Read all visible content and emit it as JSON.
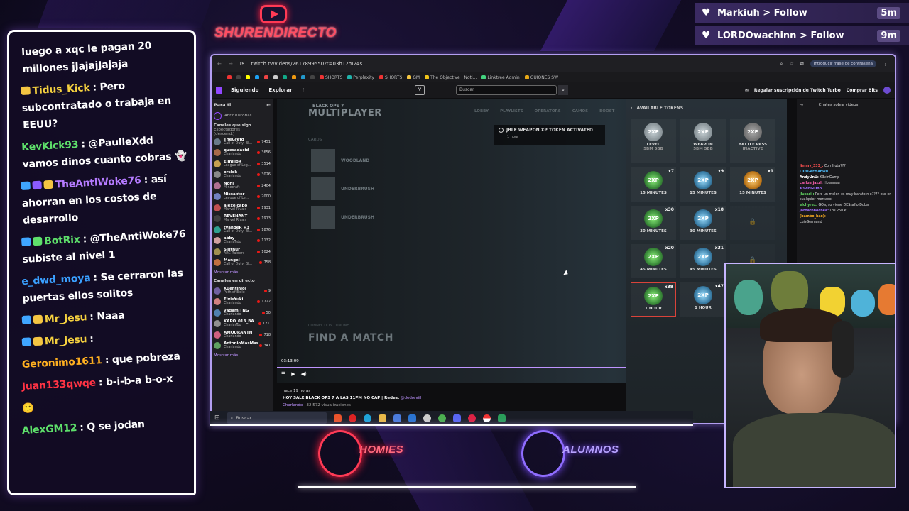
{
  "overlay": {
    "channel_name": "SHURENDIRECTO",
    "alerts": [
      {
        "user": "Markiuh",
        "action": "> Follow",
        "time": "5m"
      },
      {
        "user": "LORDOwachinn",
        "action": "> Follow",
        "time": "9m"
      }
    ],
    "bottom_logos": [
      "HOMIES",
      "ALUMNOS"
    ],
    "colors": {
      "accent_red": "#ff3a55",
      "accent_purple": "#8f6dff",
      "frame": "#ffffff"
    }
  },
  "chat": [
    {
      "user": "",
      "color": "#ffffff",
      "text": "luego a xqc le pagan 20 millones jJajajJajaja",
      "badges": []
    },
    {
      "user": "Tidus_Kick",
      "color": "#f4d03f",
      "text": ": Pero subcontratado o trabaja en EEUU?",
      "badges": [
        "#f4c542"
      ]
    },
    {
      "user": "KevKick93",
      "color": "#5ee06b",
      "text": ": @PaulleXdd vamos dinos cuanto cobras 👻",
      "badges": []
    },
    {
      "user": "TheAntiWoke76",
      "color": "#b57bff",
      "text": ": así ahorran en los costos de desarrollo",
      "badges": [
        "#3fa6ff",
        "#8b5cff",
        "#f4c542"
      ]
    },
    {
      "user": "BotRix",
      "color": "#5ee06b",
      "text": ": @TheAntiWoke76 subiste al nivel 1",
      "badges": [
        "#3fa6ff",
        "#5ee06b"
      ]
    },
    {
      "user": "e_dwd_moya",
      "color": "#3aa0ff",
      "text": ": Se cerraron las puertas ellos solitos",
      "badges": []
    },
    {
      "user": "Mr_Jesu",
      "color": "#f4d03f",
      "text": ": Naaa",
      "badges": [
        "#3fa6ff",
        "#f4c542"
      ]
    },
    {
      "user": "Mr_Jesu",
      "color": "#f4d03f",
      "text": ":",
      "badges": [
        "#3fa6ff",
        "#f4c542"
      ]
    },
    {
      "user": "Geronimo1611",
      "color": "#ffb020",
      "text": ": que pobreza",
      "badges": []
    },
    {
      "user": "Juan133qwqe",
      "color": "#ff3344",
      "text": ": b-i-b-a b-o-x",
      "badges": []
    },
    {
      "user": "",
      "color": "#ffffff",
      "text": "🙂",
      "badges": []
    },
    {
      "user": "AlexGM12",
      "color": "#5ee06b",
      "text": ": Q se jodan",
      "badges": []
    }
  ],
  "browser": {
    "url": "twitch.tv/videos/2617899550?t=03h12m24s",
    "password_prompt": "Introducir frase de contraseña",
    "bookmarks": [
      "SHORTS",
      "Perplexity",
      "SHORTS",
      "GM",
      "The Objective | Noti...",
      "Linktree Admin",
      "GUIONES SW"
    ],
    "twitch_nav": {
      "following": "Siguiendo",
      "browse": "Explorar",
      "search_placeholder": "Buscar",
      "turbo": "Regalar suscripción de Twitch Turbo",
      "bits": "Comprar Bits"
    },
    "sidebar": {
      "for_you": "Para ti",
      "open_history": "Abrir historias",
      "followed_header": "Canales que sigo",
      "followed_sub": "Espectadores (descend.)",
      "channels": [
        {
          "name": "TheGrefg",
          "game": "Call of Duty: Bl...",
          "viewers": "7451",
          "color": "#6a7a8a"
        },
        {
          "name": "quesadacid",
          "game": "Charlando",
          "viewers": "3656",
          "color": "#a86a4a"
        },
        {
          "name": "ElmilloR",
          "game": "League of Leg...",
          "viewers": "3514",
          "color": "#c6a050"
        },
        {
          "name": "orslok",
          "game": "Charlando",
          "viewers": "3026",
          "color": "#888888"
        },
        {
          "name": "Noni",
          "game": "Minecraft",
          "viewers": "2404",
          "color": "#b07090"
        },
        {
          "name": "Nissaxter",
          "game": "League of Le...",
          "viewers": "2000",
          "color": "#7080c0"
        },
        {
          "name": "alexelcapo",
          "game": "Marvel Rivals",
          "viewers": "1931",
          "color": "#c05050"
        },
        {
          "name": "REVENANT",
          "game": "Marvel Rivals",
          "viewers": "1913",
          "color": "#404040"
        },
        {
          "name": "tvandeR +3",
          "game": "Call of Duty: Bl...",
          "viewers": "1876",
          "color": "#30a090"
        },
        {
          "name": "abby_",
          "game": "Charlando",
          "viewers": "1132",
          "color": "#d0a0a0"
        },
        {
          "name": "Sillthur",
          "game": "ARC Raiders",
          "viewers": "1024",
          "color": "#a09050"
        },
        {
          "name": "Mangel",
          "game": "Call of Duty: Bl...",
          "viewers": "758",
          "color": "#c07040"
        }
      ],
      "show_more": "Mostrar más",
      "live_header": "Canales en directo",
      "live_channels": [
        {
          "name": "Kuentinlol",
          "game": "Path of Exile",
          "viewers": "9",
          "color": "#7060a0"
        },
        {
          "name": "ElvisYuki",
          "game": "Charlando",
          "viewers": "1722",
          "color": "#d08080"
        },
        {
          "name": "yagamiTNG",
          "game": "Charlando",
          "viewers": "50",
          "color": "#5080b0"
        },
        {
          "name": "KAPO_013_BA...",
          "game": "Charlando",
          "viewers": "1211",
          "color": "#909090"
        },
        {
          "name": "AMOURANTH",
          "game": "Charlando",
          "viewers": "718",
          "color": "#d06080"
        },
        {
          "name": "AntonioMasMas",
          "game": "Charlando",
          "viewers": "341",
          "color": "#60a060"
        }
      ]
    },
    "game": {
      "title": "MULTIPLAYER",
      "top_label": "BLACK OPS 7",
      "tabs": [
        "LOBBY",
        "PLAYLISTS",
        "OPERATORS",
        "CAMOS",
        "BOOST"
      ],
      "modes_header": "CARDS",
      "modes": [
        "WOODLAND",
        "UNDERBRUSH",
        "UNDERBRUSH"
      ],
      "toast_title": "JBLE WEAPON XP TOKEN ACTIVATED",
      "toast_sub": "1 hour",
      "find_match": "FIND A MATCH",
      "connection": "CONNECTION  |  ONLINE",
      "tokens_header": "AVAILABLE TOKENS",
      "tokens_top": [
        {
          "label": "LEVEL",
          "sub": "5BM 5BB"
        },
        {
          "label": "WEAPON",
          "sub": "5BM 5BB"
        },
        {
          "label": "BATTLE PASS",
          "sub": "INACTIVE"
        }
      ],
      "tokens": [
        {
          "dur": "15 MINUTES",
          "mult": "x7"
        },
        {
          "dur": "15 MINUTES",
          "mult": "x9"
        },
        {
          "dur": "15 MINUTES",
          "mult": "x1"
        },
        {
          "dur": "30 MINUTES",
          "mult": "x30"
        },
        {
          "dur": "30 MINUTES",
          "mult": "x18"
        },
        {
          "dur": "",
          "mult": ""
        },
        {
          "dur": "45 MINUTES",
          "mult": "x20"
        },
        {
          "dur": "45 MINUTES",
          "mult": "x31"
        },
        {
          "dur": "",
          "mult": ""
        },
        {
          "dur": "1 HOUR",
          "mult": "x38"
        },
        {
          "dur": "1 HOUR",
          "mult": "x47"
        }
      ],
      "timestamp": "03:13:09"
    },
    "video_info": {
      "time_ago": "hace 19 horas",
      "title": "HOY SALE BLACK OPS 7 A LAS 11PM NO CAP | Redes:",
      "handle": "@dedreviil",
      "category": "Charlando",
      "views": "· 32.572 visualizaciones"
    },
    "vod_chat": {
      "title": "Chates sobre videos",
      "messages": [
        {
          "user": "Jimmy_333_:",
          "text": "Con fruta???",
          "color": "#ff5050"
        },
        {
          "user": "LuisGermanwd",
          "text": "",
          "color": "#50c0ff"
        },
        {
          "user": "AndyUnU:",
          "text": "K3vinGump",
          "color": "#ffffff"
        },
        {
          "user": "carlosrjazzl:",
          "text": "Holaaaaa",
          "color": "#ff60b0"
        },
        {
          "user": "K3vinGump",
          "text": "",
          "color": "#a070ff"
        },
        {
          "user": "jlucarii:",
          "text": "Pero un melon es muy barato n o???? eso en cualquier mercado",
          "color": "#60d060"
        },
        {
          "user": "elchyrex:",
          "text": "GOa, so viene DESsafio Dubai",
          "color": "#60d060"
        },
        {
          "user": "jorbaronochea:",
          "text": "Los 250 k",
          "color": "#a070ff"
        },
        {
          "user": "(bambo_hax):",
          "text": "",
          "color": "#ffb020"
        },
        {
          "user": "",
          "text": "LuisGermand",
          "color": "#ffffff"
        }
      ]
    },
    "taskbar_search": "Buscar"
  }
}
